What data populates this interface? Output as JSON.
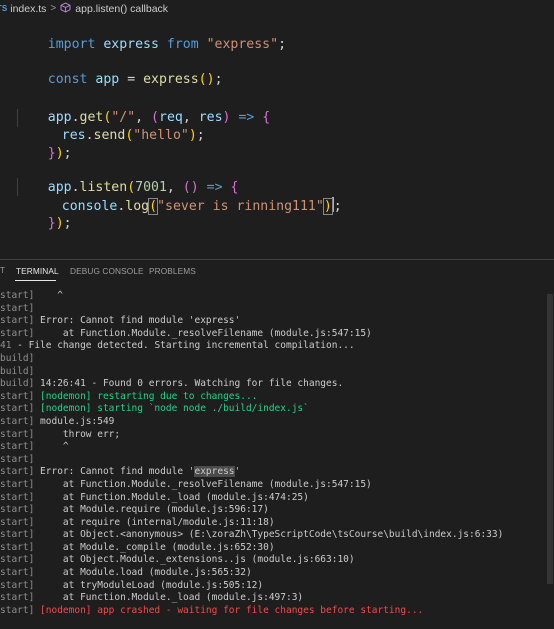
{
  "breadcrumb": {
    "file_icon": "TS",
    "file": "index.ts",
    "separator": ">",
    "symbol_icon": "function-cube-icon",
    "symbol": "app.listen() callback"
  },
  "editor": {
    "l1": {
      "a": "import",
      "b": " express ",
      "c": "from",
      "d": " ",
      "e": "\"express\"",
      "f": ";"
    },
    "l2": {
      "a": "const",
      "b": " ",
      "c": "app",
      "d": " = ",
      "e": "express",
      "f": "(",
      "g": ")",
      "h": ";"
    },
    "l3": {
      "a": "app",
      "b": ".",
      "c": "get",
      "d": "(",
      "e": "\"/\"",
      "f": ", ",
      "g": "(",
      "h": "req",
      "i": ", ",
      "j": "res",
      "k": ")",
      "l": " ",
      "m": "=>",
      "n": " ",
      "o": "{"
    },
    "l4": {
      "a": "res",
      "b": ".",
      "c": "send",
      "d": "(",
      "e": "\"hello\"",
      "f": ")",
      "g": ";"
    },
    "l5": {
      "a": "}",
      "b": ")",
      "c": ";"
    },
    "l6": {
      "a": "app",
      "b": ".",
      "c": "listen",
      "d": "(",
      "e": "7001",
      "f": ", ",
      "g": "(",
      "h": ")",
      "i": " ",
      "j": "=>",
      "k": " ",
      "l": "{"
    },
    "l7": {
      "a": "console",
      "b": ".",
      "c": "log",
      "d": "(",
      "e": "\"sever is rinning111\"",
      "f": ")",
      "g": ";"
    },
    "l8": {
      "a": "}",
      "b": ")",
      "c": ";"
    }
  },
  "panel": {
    "left_marker": "T",
    "tabs": [
      "TERMINAL",
      "DEBUG CONSOLE",
      "PROBLEMS"
    ],
    "terminal_lines": [
      {
        "prefix": "start]",
        "text": "    ^",
        "color": ""
      },
      {
        "prefix": "start]",
        "text": "",
        "color": ""
      },
      {
        "prefix": "start]",
        "text": " Error: Cannot find module 'express'",
        "color": ""
      },
      {
        "prefix": "start]",
        "text": "     at Function.Module._resolveFilename (module.js:547:15)",
        "color": ""
      },
      {
        "prefix": "41",
        "text": " - File change detected. Starting incremental compilation...",
        "color": ""
      },
      {
        "prefix": "build]",
        "text": "",
        "color": ""
      },
      {
        "prefix": "build]",
        "text": "",
        "color": ""
      },
      {
        "prefix": "build]",
        "text": " 14:26:41 - Found 0 errors. Watching for file changes.",
        "color": ""
      },
      {
        "prefix": "start]",
        "text": " [nodemon] restarting due to changes...",
        "color": "green"
      },
      {
        "prefix": "start]",
        "text": " [nodemon] starting `node node ./build/index.js`",
        "color": "green"
      },
      {
        "prefix": "start]",
        "text": " module.js:549",
        "color": ""
      },
      {
        "prefix": "start]",
        "text": "     throw err;",
        "color": ""
      },
      {
        "prefix": "start]",
        "text": "     ^",
        "color": ""
      },
      {
        "prefix": "start]",
        "text": "",
        "color": ""
      },
      {
        "prefix": "start]",
        "text": " Error: Cannot find module '",
        "highlight": "express",
        "after": "'",
        "color": ""
      },
      {
        "prefix": "start]",
        "text": "     at Function.Module._resolveFilename (module.js:547:15)",
        "color": ""
      },
      {
        "prefix": "start]",
        "text": "     at Function.Module._load (module.js:474:25)",
        "color": ""
      },
      {
        "prefix": "start]",
        "text": "     at Module.require (module.js:596:17)",
        "color": ""
      },
      {
        "prefix": "start]",
        "text": "     at require (internal/module.js:11:18)",
        "color": ""
      },
      {
        "prefix": "start]",
        "text": "     at Object.<anonymous> (E:\\zoraZh\\TypeScriptCode\\tsCourse\\build\\index.js:6:33)",
        "color": ""
      },
      {
        "prefix": "start]",
        "text": "     at Module._compile (module.js:652:30)",
        "color": ""
      },
      {
        "prefix": "start]",
        "text": "     at Object.Module._extensions..js (module.js:663:10)",
        "color": ""
      },
      {
        "prefix": "start]",
        "text": "     at Module.load (module.js:565:32)",
        "color": ""
      },
      {
        "prefix": "start]",
        "text": "     at tryModuleLoad (module.js:505:12)",
        "color": ""
      },
      {
        "prefix": "start]",
        "text": "     at Function.Module._load (module.js:497:3)",
        "color": ""
      },
      {
        "prefix": "start]",
        "text": " [nodemon] app crashed - waiting for file changes before starting...",
        "color": "red"
      }
    ]
  },
  "colors": {
    "editor_bg": "#1e1e1e",
    "keyword": "#569cd6",
    "function": "#dcdcaa",
    "variable": "#9cdcfe",
    "string": "#ce9178",
    "number": "#b5cea8",
    "terminal_green": "#23d18b",
    "terminal_red": "#f14c4c"
  }
}
